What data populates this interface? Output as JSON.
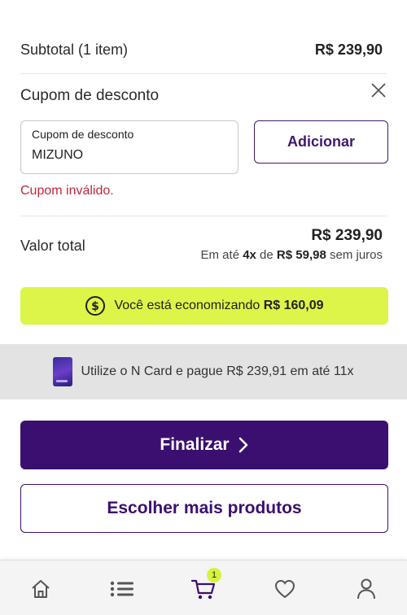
{
  "summary": {
    "subtotal_label": "Subtotal (1 item)",
    "subtotal_value": "R$ 239,90"
  },
  "coupon": {
    "title": "Cupom de desconto",
    "field_label": "Cupom de desconto",
    "field_value": "MIZUNO",
    "add_label": "Adicionar",
    "error": "Cupom inválido."
  },
  "total": {
    "label": "Valor total",
    "value": "R$ 239,90",
    "inst_prefix": "Em até ",
    "inst_count": "4x",
    "inst_mid": " de ",
    "inst_amount": "R$ 59,98",
    "inst_suffix": " sem juros"
  },
  "savings": {
    "prefix": "Você está economizando ",
    "amount": "R$ 160,09"
  },
  "ncard": {
    "text": "Utilize o N Card e pague R$ 239,91 em até 11x"
  },
  "actions": {
    "finalize": "Finalizar",
    "more": "Escolher mais produtos"
  },
  "nav": {
    "items": [
      "home-icon",
      "menu-icon",
      "cart-icon",
      "heart-icon",
      "user-icon"
    ],
    "cart_badge": "1",
    "active": "cart",
    "active_color": "#3b0f6f",
    "inactive_color": "#555555"
  },
  "colors": {
    "brand_purple": "#3b0f6f",
    "savings_green": "#dcf548",
    "error_red": "#c0263a"
  }
}
